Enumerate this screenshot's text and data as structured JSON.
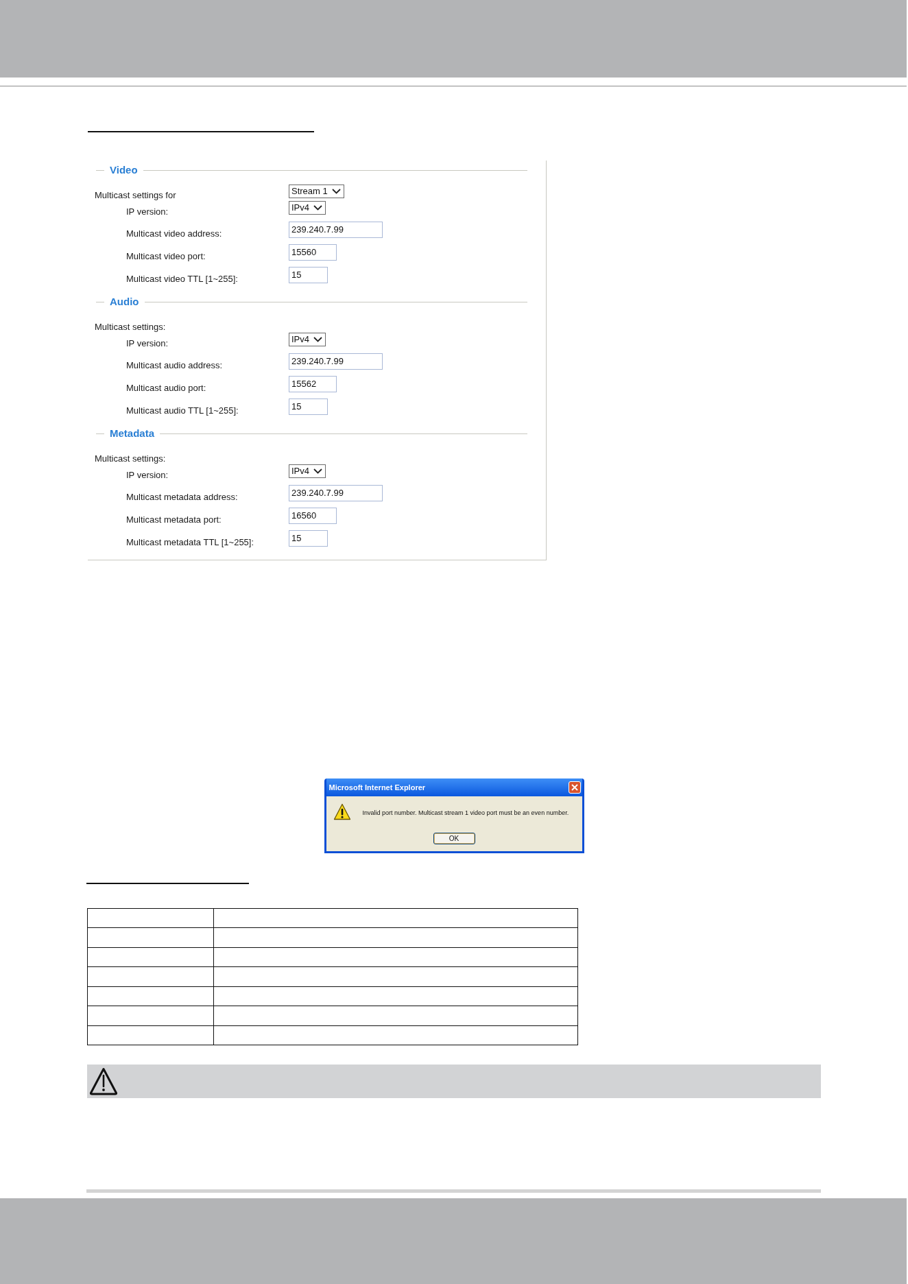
{
  "form": {
    "sections": [
      {
        "legend": "Video",
        "rows": [
          {
            "kind": "group",
            "label": "Multicast settings for",
            "value": "Stream 1"
          },
          {
            "kind": "select",
            "label": "IP version:",
            "value": "IPv4"
          },
          {
            "kind": "address",
            "label": "Multicast video address:",
            "value": "239.240.7.99"
          },
          {
            "kind": "port",
            "label": "Multicast video port:",
            "value": "15560"
          },
          {
            "kind": "ttl",
            "label": "Multicast video TTL [1~255]:",
            "value": "15"
          }
        ]
      },
      {
        "legend": "Audio",
        "rows": [
          {
            "kind": "heading",
            "label": "Multicast settings:"
          },
          {
            "kind": "select",
            "label": "IP version:",
            "value": "IPv4"
          },
          {
            "kind": "address",
            "label": "Multicast audio address:",
            "value": "239.240.7.99"
          },
          {
            "kind": "port",
            "label": "Multicast audio port:",
            "value": "15562"
          },
          {
            "kind": "ttl",
            "label": "Multicast audio TTL [1~255]:",
            "value": "15"
          }
        ]
      },
      {
        "legend": "Metadata",
        "rows": [
          {
            "kind": "heading",
            "label": "Multicast settings:"
          },
          {
            "kind": "select",
            "label": "IP version:",
            "value": "IPv4"
          },
          {
            "kind": "address",
            "label": "Multicast metadata address:",
            "value": "239.240.7.99"
          },
          {
            "kind": "port",
            "label": "Multicast metadata port:",
            "value": "16560"
          },
          {
            "kind": "ttl",
            "label": "Multicast metadata TTL [1~255]:",
            "value": "15"
          }
        ]
      }
    ]
  },
  "dialog": {
    "title": "Microsoft Internet Explorer",
    "message": "Invalid port number. Multicast stream 1 video port must be an even number.",
    "button": "OK"
  }
}
